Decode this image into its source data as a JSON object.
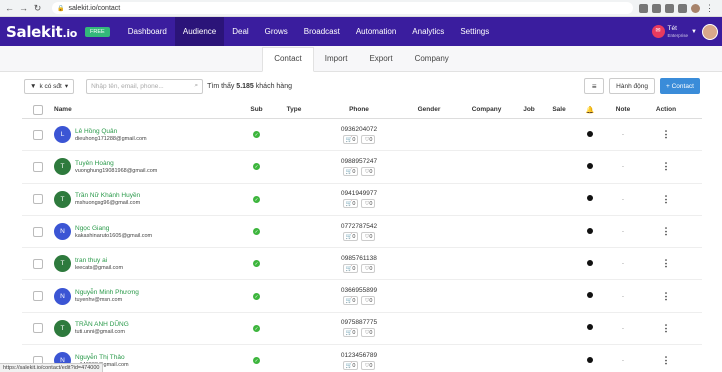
{
  "browser": {
    "url": "salekit.io/contact"
  },
  "header": {
    "logo_main": "Salekit",
    "logo_tld": ".io",
    "plan_badge": "FREE",
    "nav": [
      "Dashboard",
      "Audience",
      "Deal",
      "Grows",
      "Broadcast",
      "Automation",
      "Analytics",
      "Settings"
    ],
    "active_nav": "Audience",
    "user_name": "Tét",
    "user_role": "Enterprise"
  },
  "subnav": {
    "tabs": [
      "Contact",
      "Import",
      "Export",
      "Company"
    ],
    "active": "Contact"
  },
  "toolbar": {
    "filter_label": "k có sđt",
    "search_placeholder": "Nhập tên, email, phone...",
    "found_prefix": "Tìm thấy",
    "found_count": "5.185",
    "found_suffix": "khách hàng",
    "action_label": "Hành động",
    "add_label": "+ Contact"
  },
  "table": {
    "columns": {
      "name": "Name",
      "sub": "Sub",
      "type": "Type",
      "phone": "Phone",
      "gender": "Gender",
      "company": "Company",
      "job": "Job",
      "sale": "Sale",
      "note": "Note",
      "action": "Action"
    },
    "rows": [
      {
        "initial": "L",
        "color": "#3b55d4",
        "name": "Lê Hồng Quân",
        "email": "dieuhong171288@gmail.com",
        "phone": "0936204072",
        "cart": "0",
        "heart": "0",
        "note": "-"
      },
      {
        "initial": "T",
        "color": "#2e7a3d",
        "name": "Tuyên Hoàng",
        "email": "vuonghung19081968@gmail.com",
        "phone": "0988957247",
        "cart": "0",
        "heart": "0",
        "note": "-"
      },
      {
        "initial": "T",
        "color": "#2e7a3d",
        "name": "Trần Nữ Khánh Huyền",
        "email": "mshuongsg96@gmail.com",
        "phone": "0941949977",
        "cart": "0",
        "heart": "0",
        "note": "-"
      },
      {
        "initial": "N",
        "color": "#3b55d4",
        "name": "Ngọc Giang",
        "email": "kakashinaruto1605@gmail.com",
        "phone": "0772787542",
        "cart": "0",
        "heart": "0",
        "note": "-"
      },
      {
        "initial": "T",
        "color": "#2e7a3d",
        "name": "tran thuy ai",
        "email": "leecats@gmail.com",
        "phone": "0985761138",
        "cart": "0",
        "heart": "0",
        "note": "-"
      },
      {
        "initial": "N",
        "color": "#3b55d4",
        "name": "Nguyễn Minh Phương",
        "email": "tuyenhv@msn.com",
        "phone": "0366955899",
        "cart": "0",
        "heart": "0",
        "note": "-"
      },
      {
        "initial": "T",
        "color": "#2e7a3d",
        "name": "TRẦN ANH DŨNG",
        "email": "tuti.unni@gmail.com",
        "phone": "0975887775",
        "cart": "0",
        "heart": "0",
        "note": "-"
      },
      {
        "initial": "N",
        "color": "#3b55d4",
        "name": "Nguyễn Thị Thảo",
        "email": "g.140998@gmail.com",
        "phone": "0123456789",
        "cart": "0",
        "heart": "0",
        "note": "-"
      }
    ]
  },
  "status_bar": {
    "link": "https://salekit.io/contact/edit?id=474000"
  }
}
